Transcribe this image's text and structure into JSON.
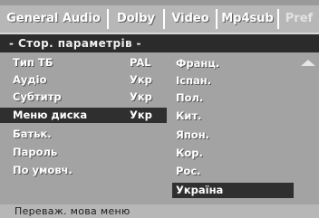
{
  "tabs": [
    "General Audio",
    "Dolby",
    "Video",
    "Mp4sub",
    "Pref"
  ],
  "header": {
    "title": "- Стор. параметрів -"
  },
  "settings": [
    {
      "label": "Тип ТБ",
      "value": "PAL"
    },
    {
      "label": "Аудіо",
      "value": "Укр"
    },
    {
      "label": "Субтитр",
      "value": "Укр"
    },
    {
      "label": "Меню диска",
      "value": "Укр"
    },
    {
      "label": "Батьк.",
      "value": ""
    },
    {
      "label": "Пароль",
      "value": ""
    },
    {
      "label": "По умовч.",
      "value": ""
    }
  ],
  "options": [
    "Франц.",
    "Іспан.",
    "Пол.",
    "Кит.",
    "Япон.",
    "Кор.",
    "Рос.",
    "Україна"
  ],
  "status": {
    "text": "Переваж. мова меню"
  },
  "colors": {
    "selected_bg": "#2f2f2f",
    "tab_bar_bg": "#b7b7b7",
    "panel_bg": "#a3a3a3"
  }
}
